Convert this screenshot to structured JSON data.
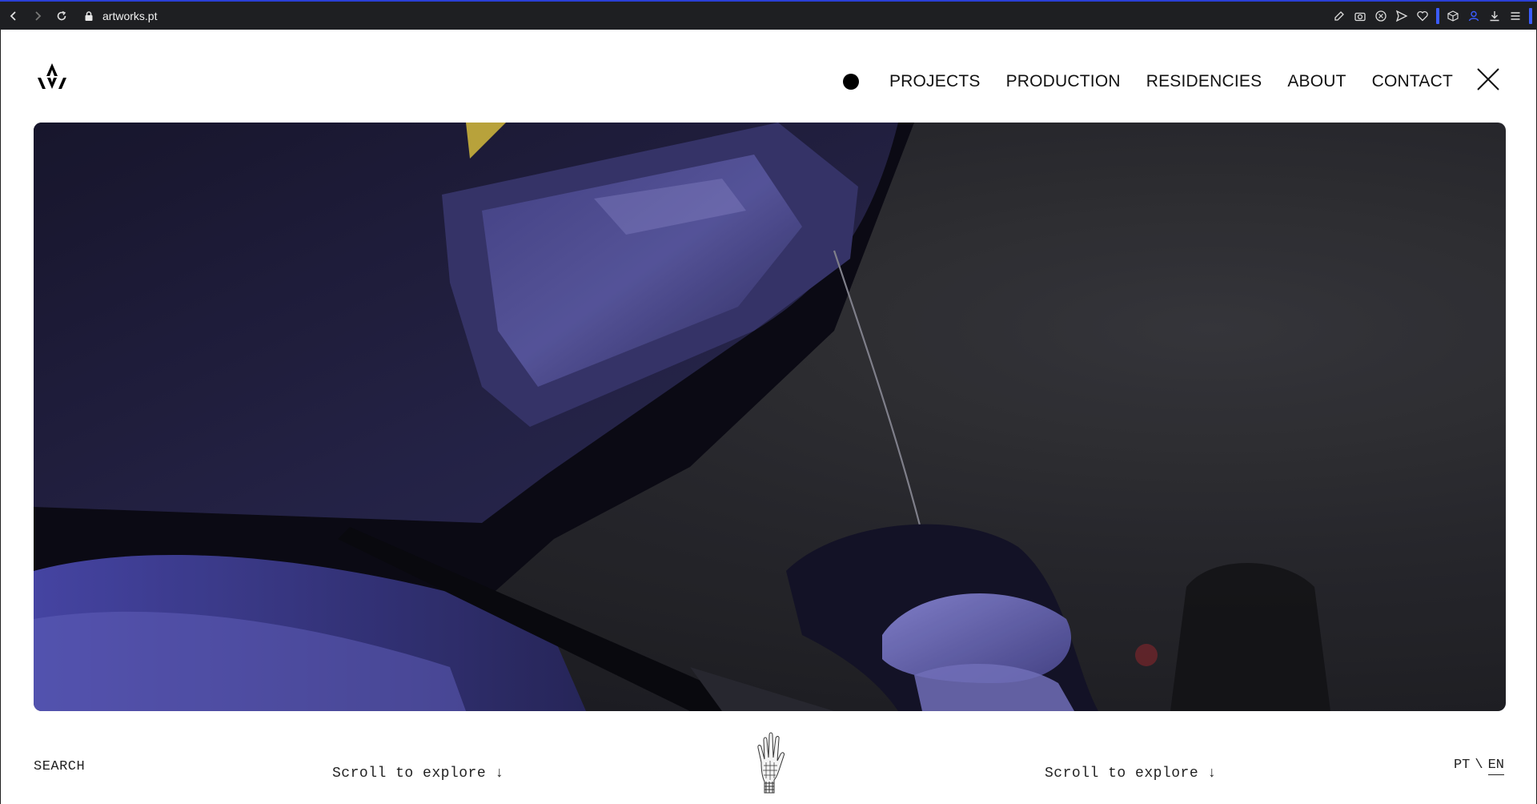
{
  "browser": {
    "url": "artworks.pt",
    "icons": [
      "back-icon",
      "forward-icon",
      "reload-icon",
      "lock-icon"
    ],
    "extensions": [
      "edit-icon",
      "camera-icon",
      "shield-icon",
      "send-icon",
      "heart-icon",
      "cube-icon",
      "profile-icon",
      "download-icon",
      "menu-icon"
    ],
    "accent_color": "#3b5cff"
  },
  "header": {
    "logo": "artworks-logo",
    "nav": [
      {
        "label": "PROJECTS"
      },
      {
        "label": "PRODUCTION"
      },
      {
        "label": "RESIDENCIES"
      },
      {
        "label": "ABOUT"
      },
      {
        "label": "CONTACT"
      }
    ],
    "close_icon": "close-icon"
  },
  "hero": {
    "image": "welder-with-helmet-video-frame"
  },
  "footer": {
    "search_label": "SEARCH",
    "scroll_left": "Scroll to explore ↓",
    "scroll_right": "Scroll to explore ↓",
    "center_icon": "glove-icon",
    "lang_pt": "PT",
    "lang_sep": "\\",
    "lang_en": "EN"
  }
}
